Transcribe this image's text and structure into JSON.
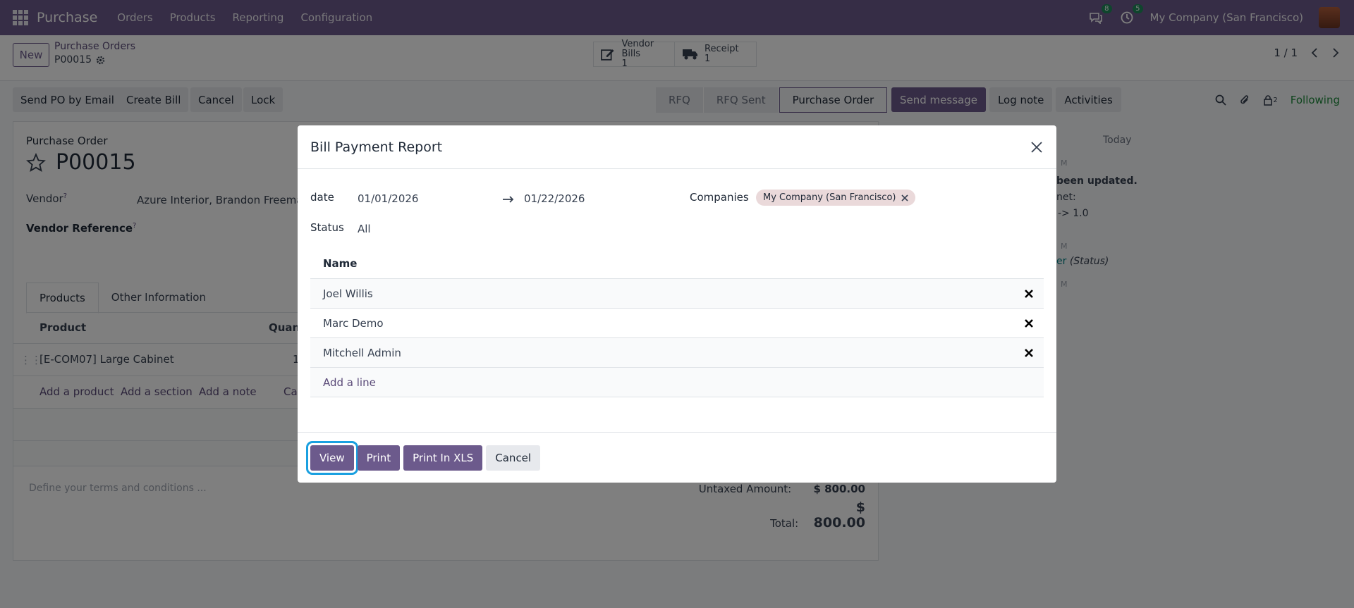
{
  "navbar": {
    "app_name": "Purchase",
    "menu": [
      "Orders",
      "Products",
      "Reporting",
      "Configuration"
    ],
    "messages_badge": "8",
    "activities_badge": "5",
    "company": "My Company (San Francisco)"
  },
  "control": {
    "new_label": "New",
    "breadcrumb": "Purchase Orders",
    "record": "P00015",
    "smart_buttons": [
      {
        "label": "Vendor Bills",
        "count": "1",
        "icon": "edit-icon"
      },
      {
        "label": "Receipt",
        "count": "1",
        "icon": "truck-icon"
      }
    ],
    "pager": "1 / 1"
  },
  "status_bar": {
    "buttons": [
      "Send PO by Email",
      "Create Bill",
      "Cancel",
      "Lock"
    ],
    "stages": [
      "RFQ",
      "RFQ Sent",
      "Purchase Order"
    ],
    "active_stage": "Purchase Order"
  },
  "chatter": {
    "send_message": "Send message",
    "log_note": "Log note",
    "activities": "Activities",
    "followers_count": "2",
    "following": "Following",
    "today": "Today",
    "line1": "been updated.",
    "line2": "net:",
    "line3": "-> 1.0",
    "line4": "er",
    "line4b": "(Status)",
    "time1": "M",
    "time2": "M",
    "time3": "M"
  },
  "form": {
    "doc_type": "Purchase Order",
    "name": "P00015",
    "vendor_label": "Vendor",
    "vendor_value": "Azure Interior, Brandon Freeman",
    "vendor_ref_label": "Vendor Reference",
    "tooltip_mark": "?",
    "tabs": [
      "Products",
      "Other Information"
    ],
    "col_product": "Product",
    "col_quantity": "Quant",
    "line_product": "[E-COM07] Large Cabinet",
    "line_qty": "1",
    "add_product": "Add a product",
    "add_section": "Add a section",
    "add_note": "Add a note",
    "catalog": "Ca",
    "terms_placeholder": "Define your terms and conditions ...",
    "untaxed_label": "Untaxed Amount:",
    "untaxed_value": "$ 800.00",
    "total_label": "Total:",
    "total_value": "$ 800.00"
  },
  "modal": {
    "title": "Bill Payment Report",
    "date_label": "date",
    "date_from": "01/01/2026",
    "date_to": "01/22/2026",
    "companies_label": "Companies",
    "company_tag": "My Company (San Francisco)",
    "status_label": "Status",
    "status_value": "All",
    "table_header": "Name",
    "rows": [
      "Joel Willis",
      "Marc Demo",
      "Mitchell Admin"
    ],
    "add_line": "Add a line",
    "buttons": {
      "view": "View",
      "print": "Print",
      "print_xls": "Print In XLS",
      "cancel": "Cancel"
    }
  },
  "colors": {
    "brand": "#6c5a8c",
    "focus": "#1aa0e0",
    "following": "#1e8a3c"
  }
}
